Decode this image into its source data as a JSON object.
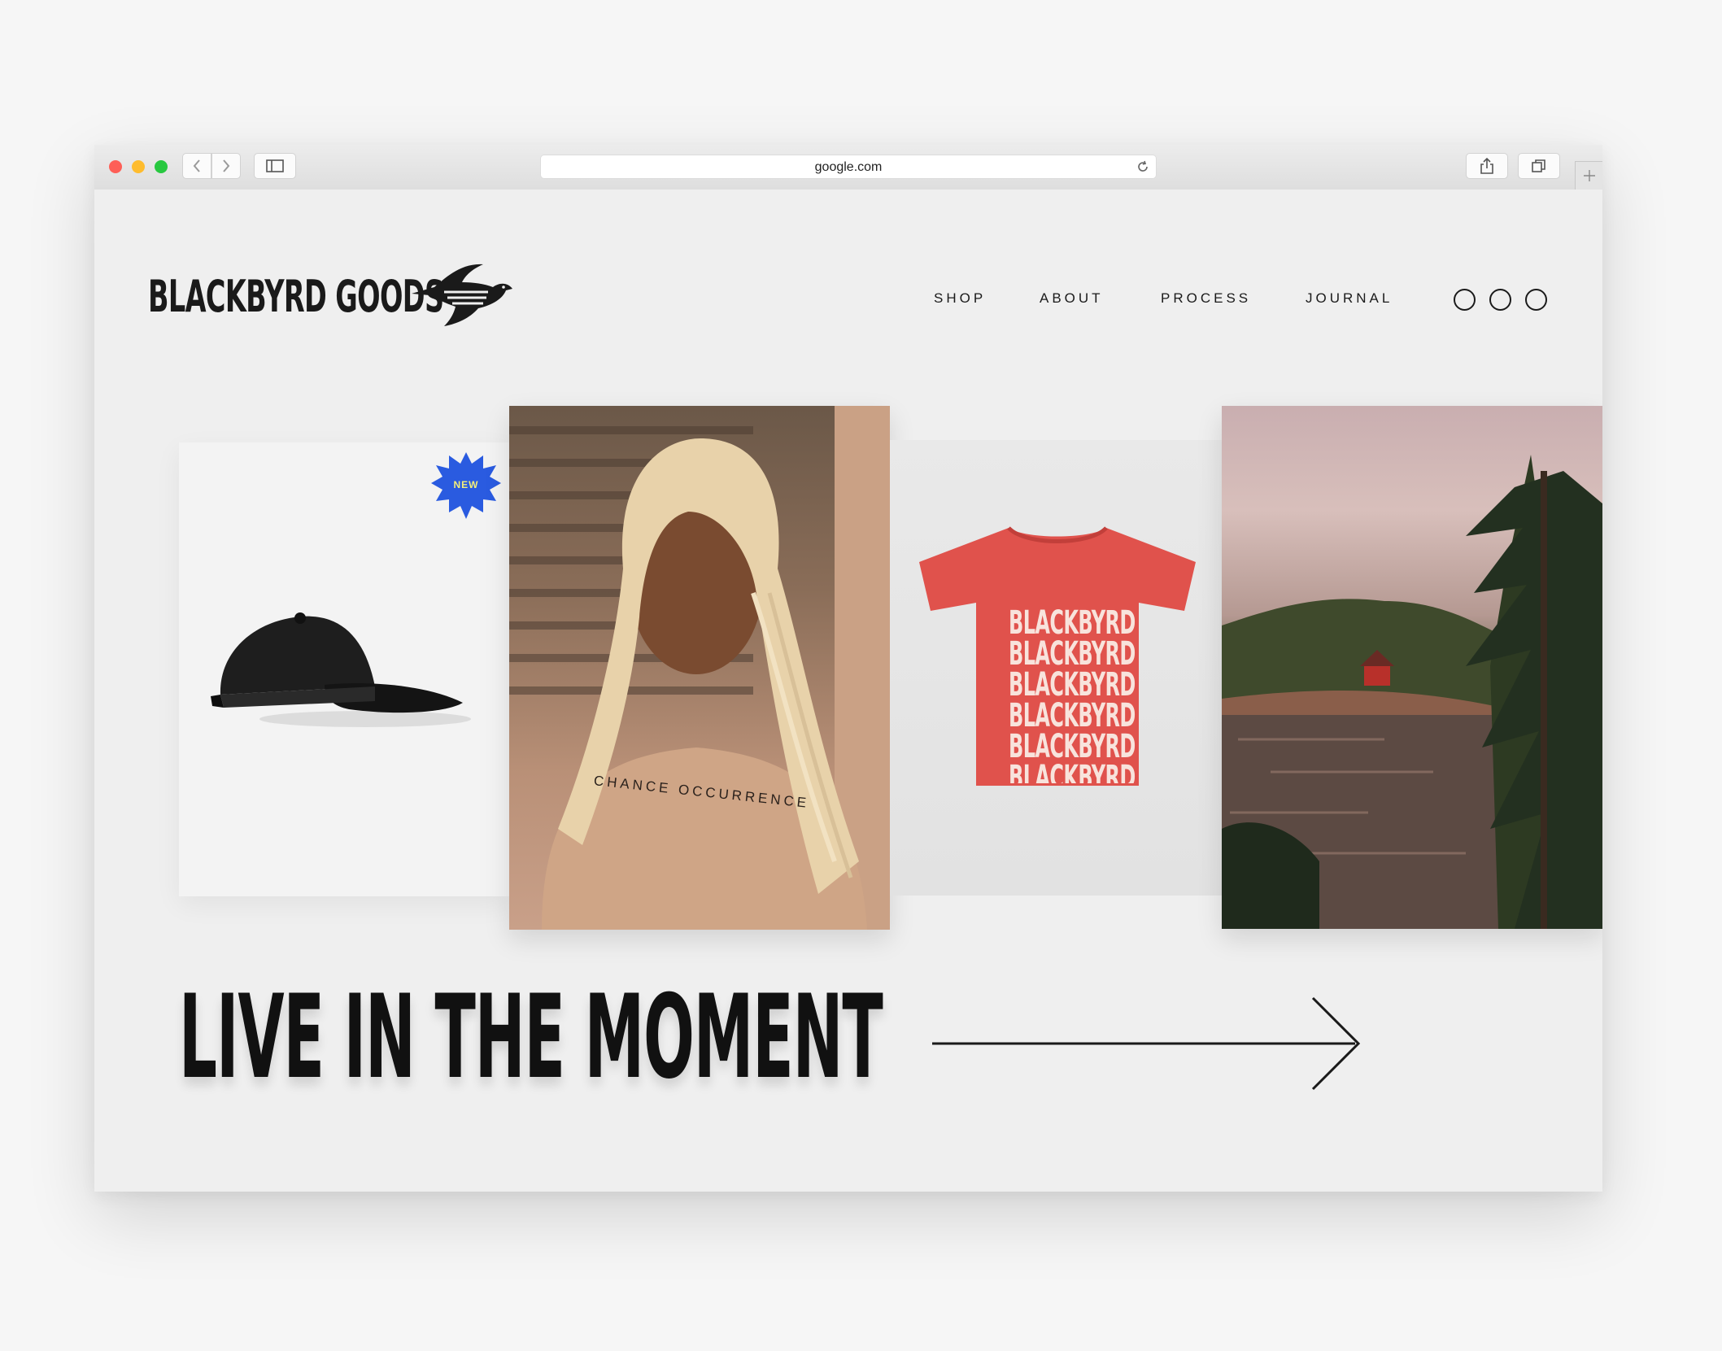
{
  "browser": {
    "url": "google.com"
  },
  "header": {
    "logo_text": "BLACKBYRD GOODS",
    "nav": [
      "SHOP",
      "ABOUT",
      "PROCESS",
      "JOURNAL"
    ]
  },
  "gallery": {
    "badge": "NEW",
    "portrait_print": "CHANCE OCCURRENCE",
    "tee_print": [
      "BLACKBYRD",
      "BLACKBYRD",
      "BLACKBYRD",
      "BLACKBYRD",
      "BLACKBYRD",
      "BLACKBYRD"
    ]
  },
  "hero": {
    "headline": "LIVE IN THE MOMENT"
  },
  "colors": {
    "badge": "#2a5be0",
    "badge_text": "#f4ef7a",
    "tee": "#e0524c",
    "ink": "#1a1a1a"
  }
}
